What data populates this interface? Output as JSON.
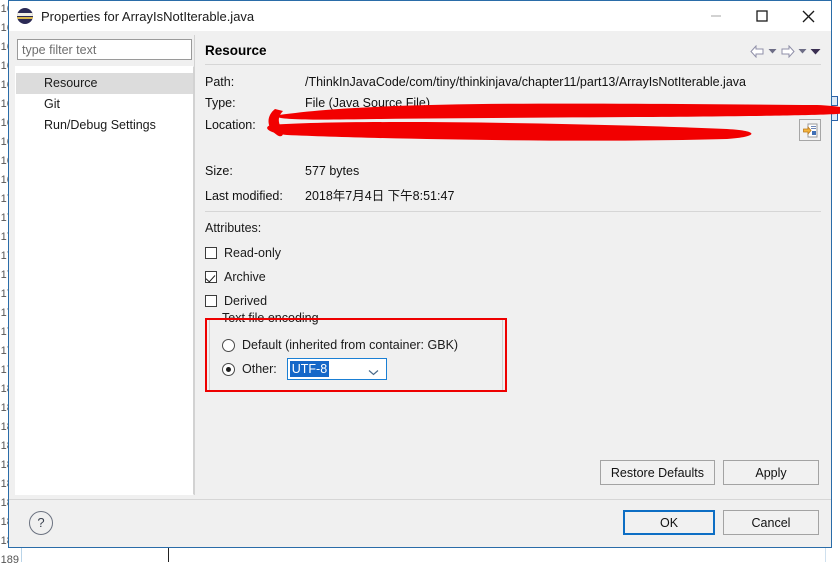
{
  "window": {
    "title": "Properties for ArrayIsNotIterable.java",
    "app_icon": "eclipse-globe-icon",
    "controls": {
      "minimize": "minimize-icon",
      "maximize": "maximize-icon",
      "close": "close-icon"
    }
  },
  "sidebar": {
    "filter": {
      "placeholder": "type filter text",
      "value": ""
    },
    "items": [
      {
        "label": "Resource",
        "selected": true
      },
      {
        "label": "Git",
        "selected": false
      },
      {
        "label": "Run/Debug Settings",
        "selected": false
      }
    ]
  },
  "page": {
    "title": "Resource",
    "nav": {
      "back": "back-arrow-icon",
      "back_menu": "chevron-down-icon",
      "forward": "forward-arrow-icon",
      "forward_menu": "chevron-down-icon",
      "view_menu": "view-menu-icon"
    },
    "fields": [
      {
        "label": "Path:",
        "value": "/ThinkInJavaCode/com/tiny/thinkinjava/chapter11/part13/ArrayIsNotIterable.java"
      },
      {
        "label": "Type:",
        "value": "File  (Java Source File)"
      },
      {
        "label": "Location:",
        "value_line1": "",
        "value_line2": "",
        "redacted": true,
        "button": "open-location-icon"
      },
      {
        "label": "Size:",
        "value": "577   bytes"
      },
      {
        "label": "Last modified:",
        "value": "2018年7月4日 下午8:51:47"
      }
    ],
    "attributes": {
      "title": "Attributes:",
      "items": [
        {
          "label": "Read-only",
          "checked": false
        },
        {
          "label": "Archive",
          "checked": true
        },
        {
          "label": "Derived",
          "checked": false
        }
      ]
    },
    "encoding": {
      "legend": "Text file encoding",
      "highlight_color": "#ee0000",
      "options": [
        {
          "label": "Default (inherited from container: GBK)",
          "selected": false
        },
        {
          "label": "Other:",
          "selected": true
        }
      ],
      "combo": {
        "value": "UTF-8"
      }
    },
    "page_buttons": [
      {
        "label": "Restore Defaults"
      },
      {
        "label": "Apply"
      }
    ]
  },
  "footer": {
    "help": "?",
    "buttons": [
      {
        "label": "OK",
        "primary": true
      },
      {
        "label": "Cancel",
        "primary": false
      }
    ]
  }
}
